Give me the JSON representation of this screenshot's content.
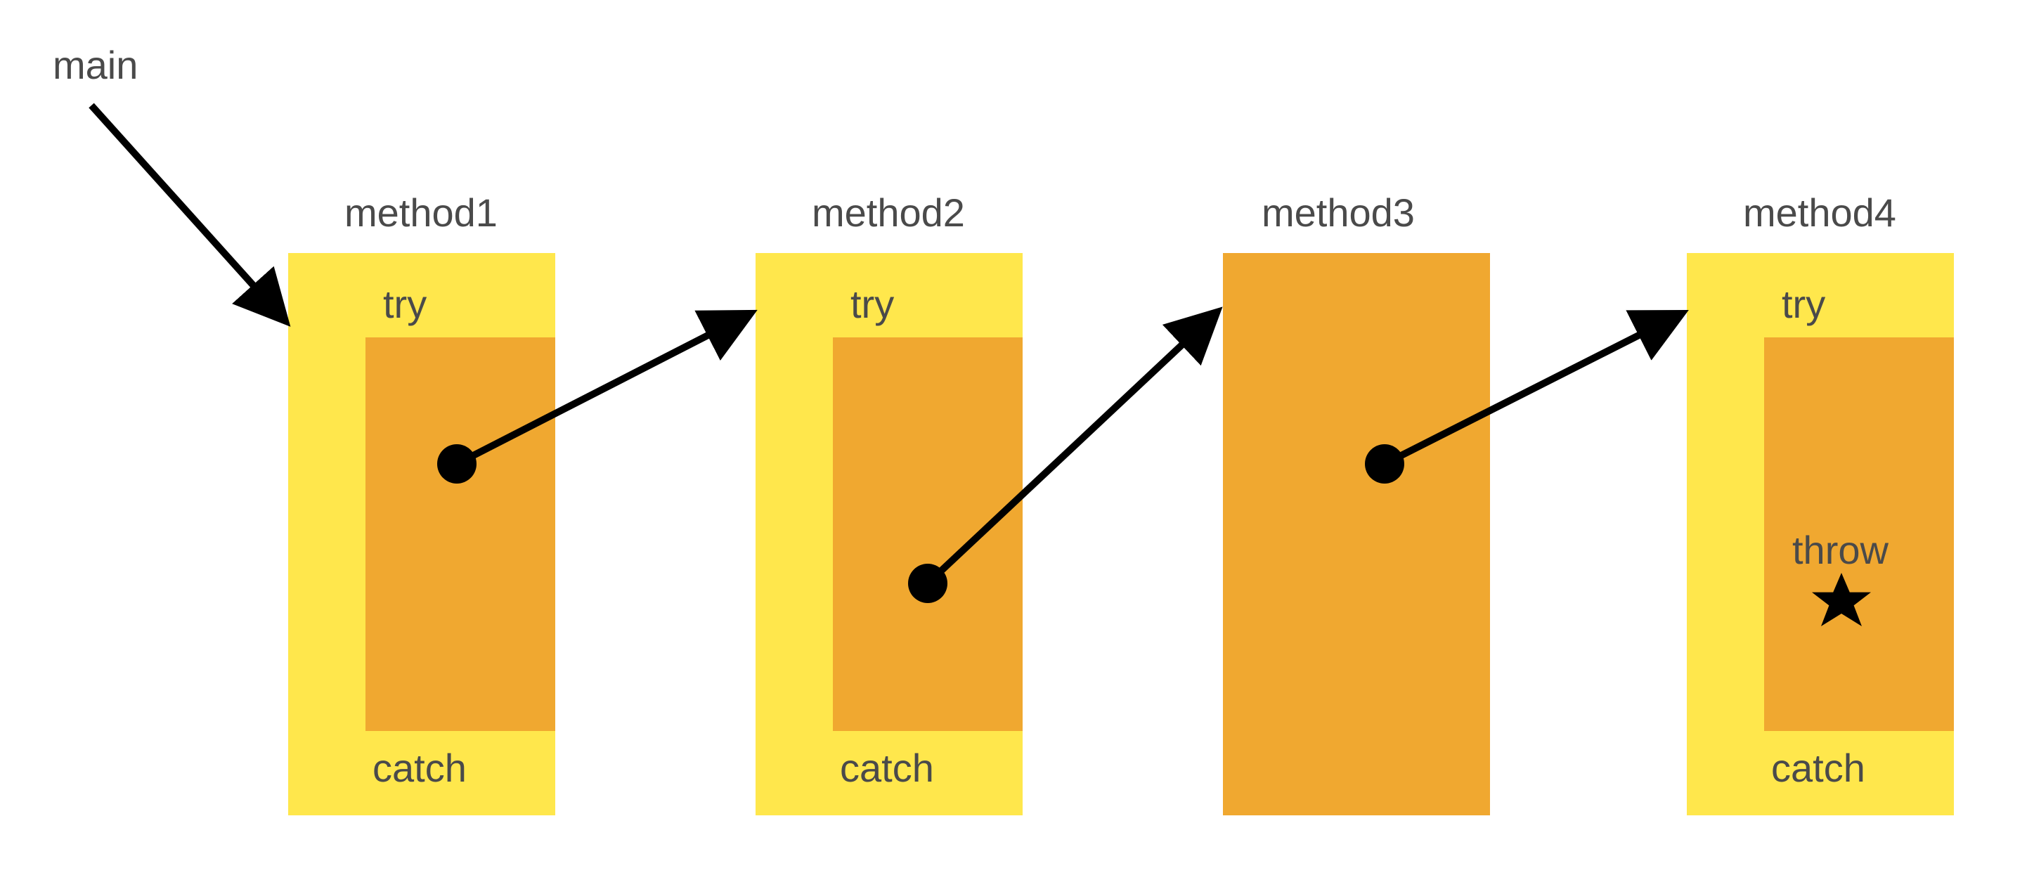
{
  "labels": {
    "main": "main",
    "method1": "method1",
    "method2": "method2",
    "method3": "method3",
    "method4": "method4",
    "try": "try",
    "catch": "catch",
    "throw": "throw"
  },
  "colors": {
    "outerBox": "#ffe74c",
    "innerBox": "#f0a830",
    "text": "#4a4a4a",
    "arrow": "#000000"
  },
  "diagram": {
    "description": "Exception handling call chain: main calls method1 (try/catch), method1 calls method2 (try/catch), method2 calls method3 (no try/catch), method3 calls method4 (try/catch) which throws an exception.",
    "nodes": [
      {
        "id": "main",
        "hasTryCatch": false
      },
      {
        "id": "method1",
        "hasTryCatch": true
      },
      {
        "id": "method2",
        "hasTryCatch": true
      },
      {
        "id": "method3",
        "hasTryCatch": false
      },
      {
        "id": "method4",
        "hasTryCatch": true,
        "throws": true
      }
    ],
    "edges": [
      {
        "from": "main",
        "to": "method1"
      },
      {
        "from": "method1",
        "to": "method2"
      },
      {
        "from": "method2",
        "to": "method3"
      },
      {
        "from": "method3",
        "to": "method4"
      }
    ]
  }
}
